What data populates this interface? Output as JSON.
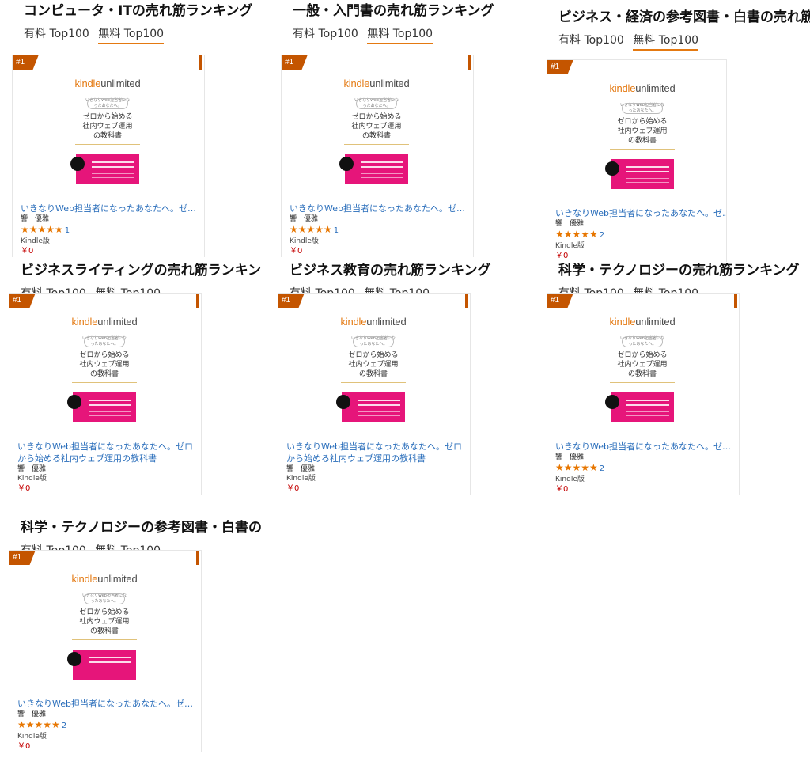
{
  "tabs": {
    "paid": "有料 Top100",
    "free": "無料 Top100"
  },
  "book": {
    "rank": "#1",
    "cover": {
      "ku_kindle": "kindle",
      "ku_unlimited": "unlimited",
      "ribbon_text": "いきなりWeb担当者になったあなたへ。",
      "title_line1": "ゼロから始める",
      "title_line2": "社内ウェブ運用",
      "title_line3": "の教科書"
    },
    "title_full": "いきなりWeb担当者になったあなたへ。ゼロから始める社内ウェブ運用の教科書",
    "title_truncated": "いきなりWeb担当者になったあなたへ。ゼロ…",
    "author": "響　優雅",
    "stars": "★★★★★",
    "format": "Kindle版",
    "price": "￥0"
  },
  "sections": [
    {
      "title": "コンピュータ・ITの売れ筋ランキング",
      "rating_count": "1"
    },
    {
      "title": "一般・入門書の売れ筋ランキング",
      "rating_count": "1"
    },
    {
      "title": "ビジネス・経済の参考図書・白書の売れ筋ラ",
      "rating_count": "2"
    },
    {
      "title": "ビジネスライティングの売れ筋ランキン",
      "rating_count": ""
    },
    {
      "title": "ビジネス教育の売れ筋ランキング",
      "rating_count": ""
    },
    {
      "title": "科学・テクノロジーの売れ筋ランキング",
      "rating_count": "2"
    },
    {
      "title": "科学・テクノロジーの参考図書・白書の",
      "rating_count": "2"
    }
  ],
  "colors": {
    "accent": "#e47911",
    "badge": "#c45500",
    "link": "#2a6ebb",
    "price": "#c40000",
    "star": "#e77600"
  }
}
